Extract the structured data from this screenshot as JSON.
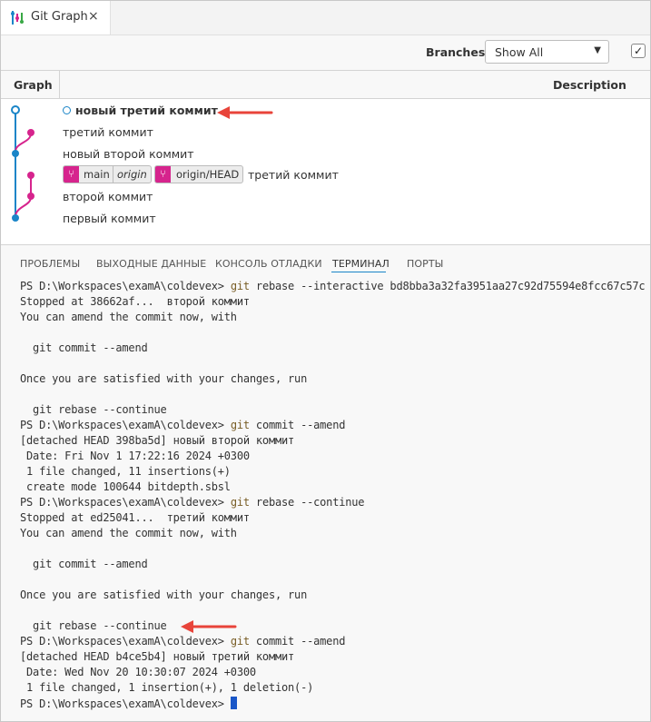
{
  "tab": {
    "title": "Git Graph",
    "close": "×"
  },
  "toolbar": {
    "branches_label": "Branches:",
    "branches_value": "Show All",
    "checkbox_checked": "✓"
  },
  "graph": {
    "col_graph": "Graph",
    "col_description": "Description",
    "rows": [
      {
        "text": "новый третий коммит"
      },
      {
        "text": "третий коммит"
      },
      {
        "text": "новый второй коммит"
      },
      {
        "text": "третий коммит",
        "refs": [
          "main",
          "origin",
          "origin/HEAD"
        ]
      },
      {
        "text": "второй коммит"
      },
      {
        "text": "первый коммит"
      }
    ],
    "colors": {
      "main_line": "#1a85c8",
      "branch_line": "#d6248d"
    }
  },
  "panel_tabs": [
    "ПРОБЛЕМЫ",
    "ВЫХОДНЫЕ ДАННЫЕ",
    "КОНСОЛЬ ОТЛАДКИ",
    "ТЕРМИНАЛ",
    "ПОРТЫ"
  ],
  "terminal": {
    "lines": [
      {
        "prompt": "PS D:\\Workspaces\\examA\\coldevex> ",
        "cmd": "git",
        "rest": " rebase --interactive bd8bba3a32fa3951aa27c92d75594e8fcc67c57c"
      },
      {
        "text": "Stopped at 38662af...  второй коммит"
      },
      {
        "text": "You can amend the commit now, with"
      },
      {
        "text": ""
      },
      {
        "text": "  git commit --amend"
      },
      {
        "text": ""
      },
      {
        "text": "Once you are satisfied with your changes, run"
      },
      {
        "text": ""
      },
      {
        "text": "  git rebase --continue"
      },
      {
        "prompt": "PS D:\\Workspaces\\examA\\coldevex> ",
        "cmd": "git",
        "rest": " commit --amend"
      },
      {
        "text": "[detached HEAD 398ba5d] новый второй коммит"
      },
      {
        "text": " Date: Fri Nov 1 17:22:16 2024 +0300"
      },
      {
        "text": " 1 file changed, 11 insertions(+)"
      },
      {
        "text": " create mode 100644 bitdepth.sbsl"
      },
      {
        "prompt": "PS D:\\Workspaces\\examA\\coldevex> ",
        "cmd": "git",
        "rest": " rebase --continue"
      },
      {
        "text": "Stopped at ed25041...  третий коммит"
      },
      {
        "text": "You can amend the commit now, with"
      },
      {
        "text": ""
      },
      {
        "text": "  git commit --amend"
      },
      {
        "text": ""
      },
      {
        "text": "Once you are satisfied with your changes, run"
      },
      {
        "text": ""
      },
      {
        "text": "  git rebase --continue"
      },
      {
        "prompt": "PS D:\\Workspaces\\examA\\coldevex> ",
        "cmd": "git",
        "rest": " commit --amend"
      },
      {
        "text": "[detached HEAD b4ce5b4] новый третий коммит"
      },
      {
        "text": " Date: Wed Nov 20 10:30:07 2024 +0300"
      },
      {
        "text": " 1 file changed, 1 insertion(+), 1 deletion(-)"
      },
      {
        "prompt": "PS D:\\Workspaces\\examA\\coldevex> ",
        "cursor": true
      }
    ]
  },
  "annotation_color": "#e8443a"
}
